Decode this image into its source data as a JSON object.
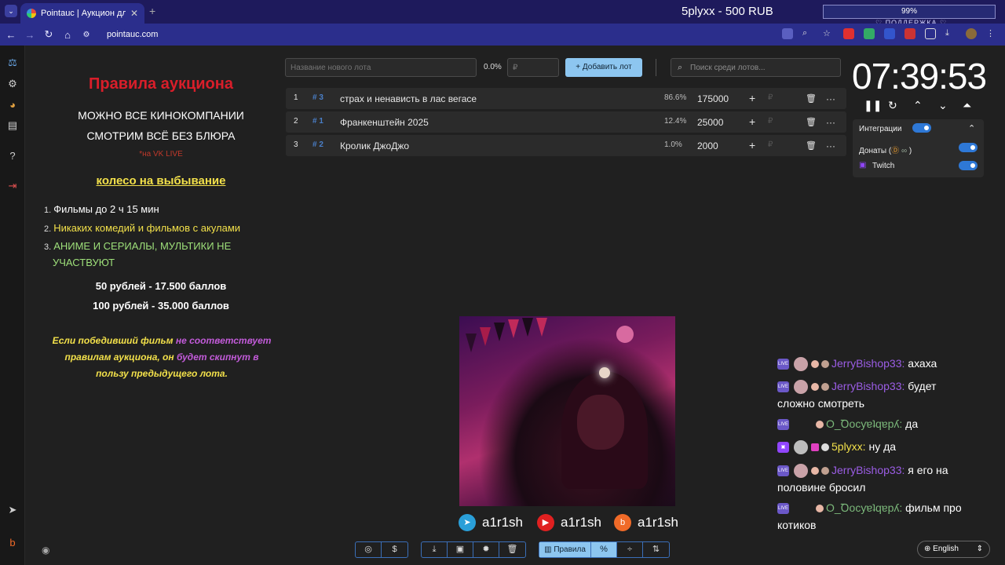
{
  "browser": {
    "tab_title": "Pointauc | Аукцион для стримера",
    "url": "pointauc.com",
    "donation_title": "5plyxx - 500 RUB",
    "donation_progress": "99%",
    "support_label": "♡ ПОДДЕРЖКА ♡"
  },
  "rules": {
    "title": "Правила аукциона",
    "line1": "МОЖНО ВСЕ КИНОКОМПАНИИ",
    "line2": "СМОТРИМ ВСЁ БЕЗ БЛЮРА",
    "vk_note": "*на VK LIVE",
    "wheel": "колесо на выбывание",
    "items": [
      "Фильмы до 2 ч 15 мин",
      "Никаких комедий и фильмов с акулами",
      "АНИМЕ И СЕРИАЛЫ, МУЛЬТИКИ НЕ",
      "УЧАСТВУЮТ"
    ],
    "price1": "50 рублей - 17.500 баллов",
    "price2": "100 рублей - 35.000 баллов",
    "note_a": "Если победивший фильм ",
    "note_b": "не соответствует",
    "note_c": "правилам аукциона, он ",
    "note_d": "будет скипнут в",
    "note_e": "пользу предыдущего лота."
  },
  "lots_toolbar": {
    "new_lot_placeholder": "Название нового лота",
    "total_pct": "0.0%",
    "amount_placeholder": "₽",
    "add_lot_label": "Добавить лот",
    "search_placeholder": "Поиск среди лотов..."
  },
  "lots": [
    {
      "idx": "1",
      "hash": "# 3",
      "name": "страх и ненависть в лас вегасе",
      "pct": "86.6%",
      "amount": "175000"
    },
    {
      "idx": "2",
      "hash": "# 1",
      "name": "Франкенштейн 2025",
      "pct": "12.4%",
      "amount": "25000"
    },
    {
      "idx": "3",
      "hash": "# 2",
      "name": "Кролик ДжоДжо",
      "pct": "1.0%",
      "amount": "2000"
    }
  ],
  "timer": {
    "time": "07:39:53"
  },
  "integrations": {
    "title": "Интеграции",
    "donations": "Донаты (",
    "donations_end": ")",
    "twitch": "Twitch"
  },
  "socials": [
    {
      "handle": "a1r1sh",
      "icon": "telegram-icon",
      "color": "#2a9fd8"
    },
    {
      "handle": "a1r1sh",
      "icon": "youtube-icon",
      "color": "#e02020"
    },
    {
      "handle": "a1r1sh",
      "icon": "boosty-icon",
      "color": "#f06a28"
    }
  ],
  "bottom_toolbar": {
    "rules_label": "Правила",
    "pct_label": "%"
  },
  "chat": [
    {
      "user": "JerryBishop33:",
      "text": " ахаха"
    },
    {
      "user": "JerryBishop33:",
      "text": " будет",
      "cont": "сложно смотреть"
    },
    {
      "user": "O_Ꝺocyɐʇqɐpʎ:",
      "text": " да"
    },
    {
      "user": "5plyxx:",
      "text": " ну да"
    },
    {
      "user": "JerryBishop33:",
      "text": " я его на",
      "cont": "половине бросил"
    },
    {
      "user": "O_Ꝺocyɐʇqɐpʎ:",
      "text": " фильм про",
      "cont": "котиков"
    }
  ],
  "language": "English",
  "colors": {
    "accent": "#8dc6f0",
    "title_red": "#d91e2a",
    "yellow": "#f2e04a"
  }
}
